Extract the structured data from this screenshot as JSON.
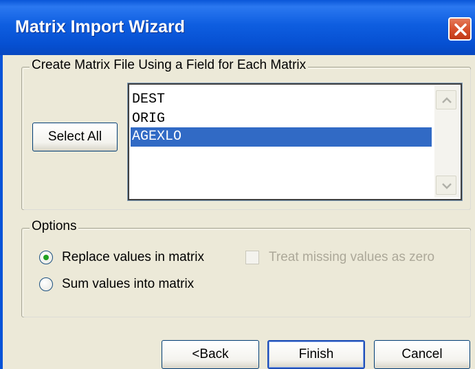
{
  "window": {
    "title": "Matrix Import Wizard"
  },
  "field_group": {
    "legend": "Create Matrix File Using a Field for Each Matrix",
    "select_all_label": "Select All",
    "fields": [
      {
        "label": "DEST",
        "selected": false
      },
      {
        "label": "ORIG",
        "selected": false
      },
      {
        "label": "AGEXLO",
        "selected": true
      }
    ]
  },
  "options_group": {
    "legend": "Options",
    "replace_label": "Replace values in matrix",
    "replace_checked": true,
    "sum_label": "Sum values into matrix",
    "sum_checked": false,
    "treat_missing_label": "Treat missing values as zero",
    "treat_missing_checked": false,
    "treat_missing_enabled": false
  },
  "buttons": {
    "back_label": "<Back",
    "finish_label": "Finish",
    "cancel_label": "Cancel"
  },
  "colors": {
    "titlebar": "#0a56d8",
    "selection": "#316ac5",
    "dialog_bg": "#ece9d8",
    "close_button": "#d8522e"
  }
}
